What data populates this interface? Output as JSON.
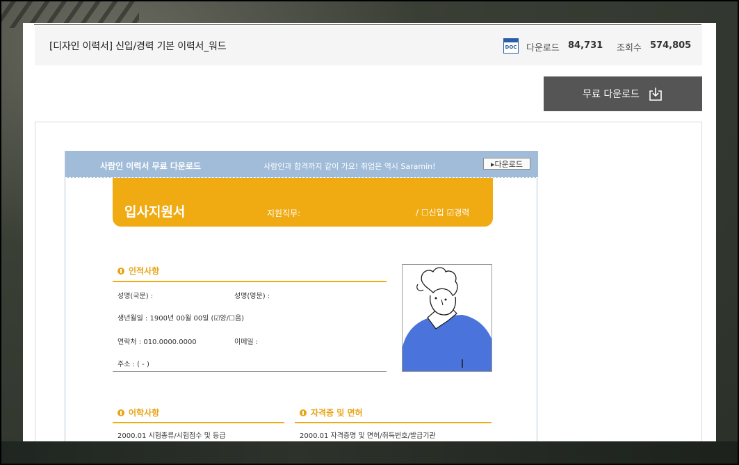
{
  "document": {
    "title": "[디자인 이력서] 신입/경력 기본 이력서_워드",
    "file_icon_text": "DOC",
    "download_label": "다운로드",
    "download_count": "84,731",
    "views_label": "조회수",
    "views_count": "574,805"
  },
  "actions": {
    "free_download_label": "무료 다운로드"
  },
  "preview": {
    "banner_title": "사람인 이력서 무료 다운로드",
    "banner_slogan": "사람인과 합격까지 같이 가요! 취업은 역시 Saramin!",
    "banner_button": "▸다운로드",
    "header_title": "입사지원서",
    "header_field": "지원직무:",
    "header_type": "/ ☐신입  ☑경력",
    "personal": {
      "section_title": "인적사항",
      "name_kr": "성명(국문) :",
      "name_en": "성명(영문) :",
      "birth": "생년월일  : 1900년  00월  00일  (☑양/☐음)",
      "contact": "연락처  : 010.0000.0000",
      "email": "이메일  :",
      "address": "주소  : (        -        )"
    },
    "language": {
      "section_title": "어학사항",
      "row": "2000.01    시험종류/시험점수 및 등급"
    },
    "license": {
      "section_title": "자격증 및 면허",
      "row": "2000.01    자격증명 및 면허/취득번호/발급기관"
    }
  },
  "colors": {
    "accent_orange": "#f0aa12",
    "banner_blue": "#a1bcd9",
    "button_gray": "#555555",
    "icon_blue": "#2b5ea8"
  }
}
